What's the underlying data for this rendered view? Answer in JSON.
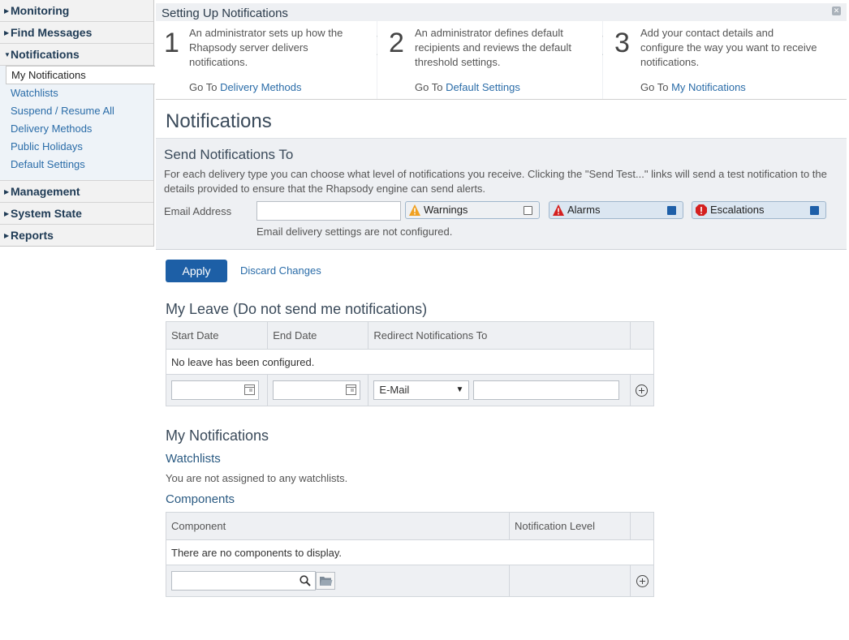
{
  "sidebar": {
    "sections": [
      {
        "label": "Monitoring"
      },
      {
        "label": "Find Messages"
      },
      {
        "label": "Notifications"
      }
    ],
    "notifications_items": [
      {
        "label": "My Notifications"
      },
      {
        "label": "Watchlists"
      },
      {
        "label": "Suspend / Resume All"
      },
      {
        "label": "Delivery Methods"
      },
      {
        "label": "Public Holidays"
      },
      {
        "label": "Default Settings"
      }
    ],
    "lower_sections": [
      {
        "label": "Management"
      },
      {
        "label": "System State"
      },
      {
        "label": "Reports"
      }
    ]
  },
  "setup": {
    "title": "Setting Up Notifications",
    "steps": [
      {
        "number": "1",
        "text": "An administrator sets up how the Rhapsody server delivers notifications.",
        "goto_prefix": "Go To ",
        "link": "Delivery Methods"
      },
      {
        "number": "2",
        "text": "An administrator defines default recipients and reviews the default threshold settings.",
        "goto_prefix": "Go To ",
        "link": "Default Settings"
      },
      {
        "number": "3",
        "text": "Add your contact details and configure the way you want to receive notifications.",
        "goto_prefix": "Go To ",
        "link": "My Notifications"
      }
    ]
  },
  "main": {
    "title": "Notifications",
    "send": {
      "title": "Send Notifications To",
      "description": "For each delivery type you can choose what level of notifications you receive. Clicking the \"Send Test...\" links will send a test notification to the details provided to ensure that the Rhapsody engine can send alerts.",
      "email_label": "Email Address",
      "email_value": "",
      "levels": [
        {
          "label": "Warnings",
          "checked": false,
          "color": "#f0a020"
        },
        {
          "label": "Alarms",
          "checked": true,
          "color": "#d42020"
        },
        {
          "label": "Escalations",
          "checked": true,
          "color": "#d42020"
        }
      ],
      "note": "Email delivery settings are not configured."
    },
    "apply_label": "Apply",
    "discard_label": "Discard Changes",
    "leave": {
      "title": "My Leave (Do not send me notifications)",
      "columns": [
        "Start Date",
        "End Date",
        "Redirect Notifications To"
      ],
      "empty": "No leave has been configured.",
      "redirect_selected": "E-Mail"
    },
    "my_notifications": {
      "title": "My Notifications",
      "watchlists_title": "Watchlists",
      "watchlists_empty": "You are not assigned to any watchlists.",
      "components_title": "Components",
      "columns": [
        "Component",
        "Notification Level"
      ],
      "empty": "There are no components to display."
    }
  },
  "colors": {
    "accent": "#1d5fa6",
    "link": "#2a6ca8",
    "panel": "#eef0f3"
  }
}
